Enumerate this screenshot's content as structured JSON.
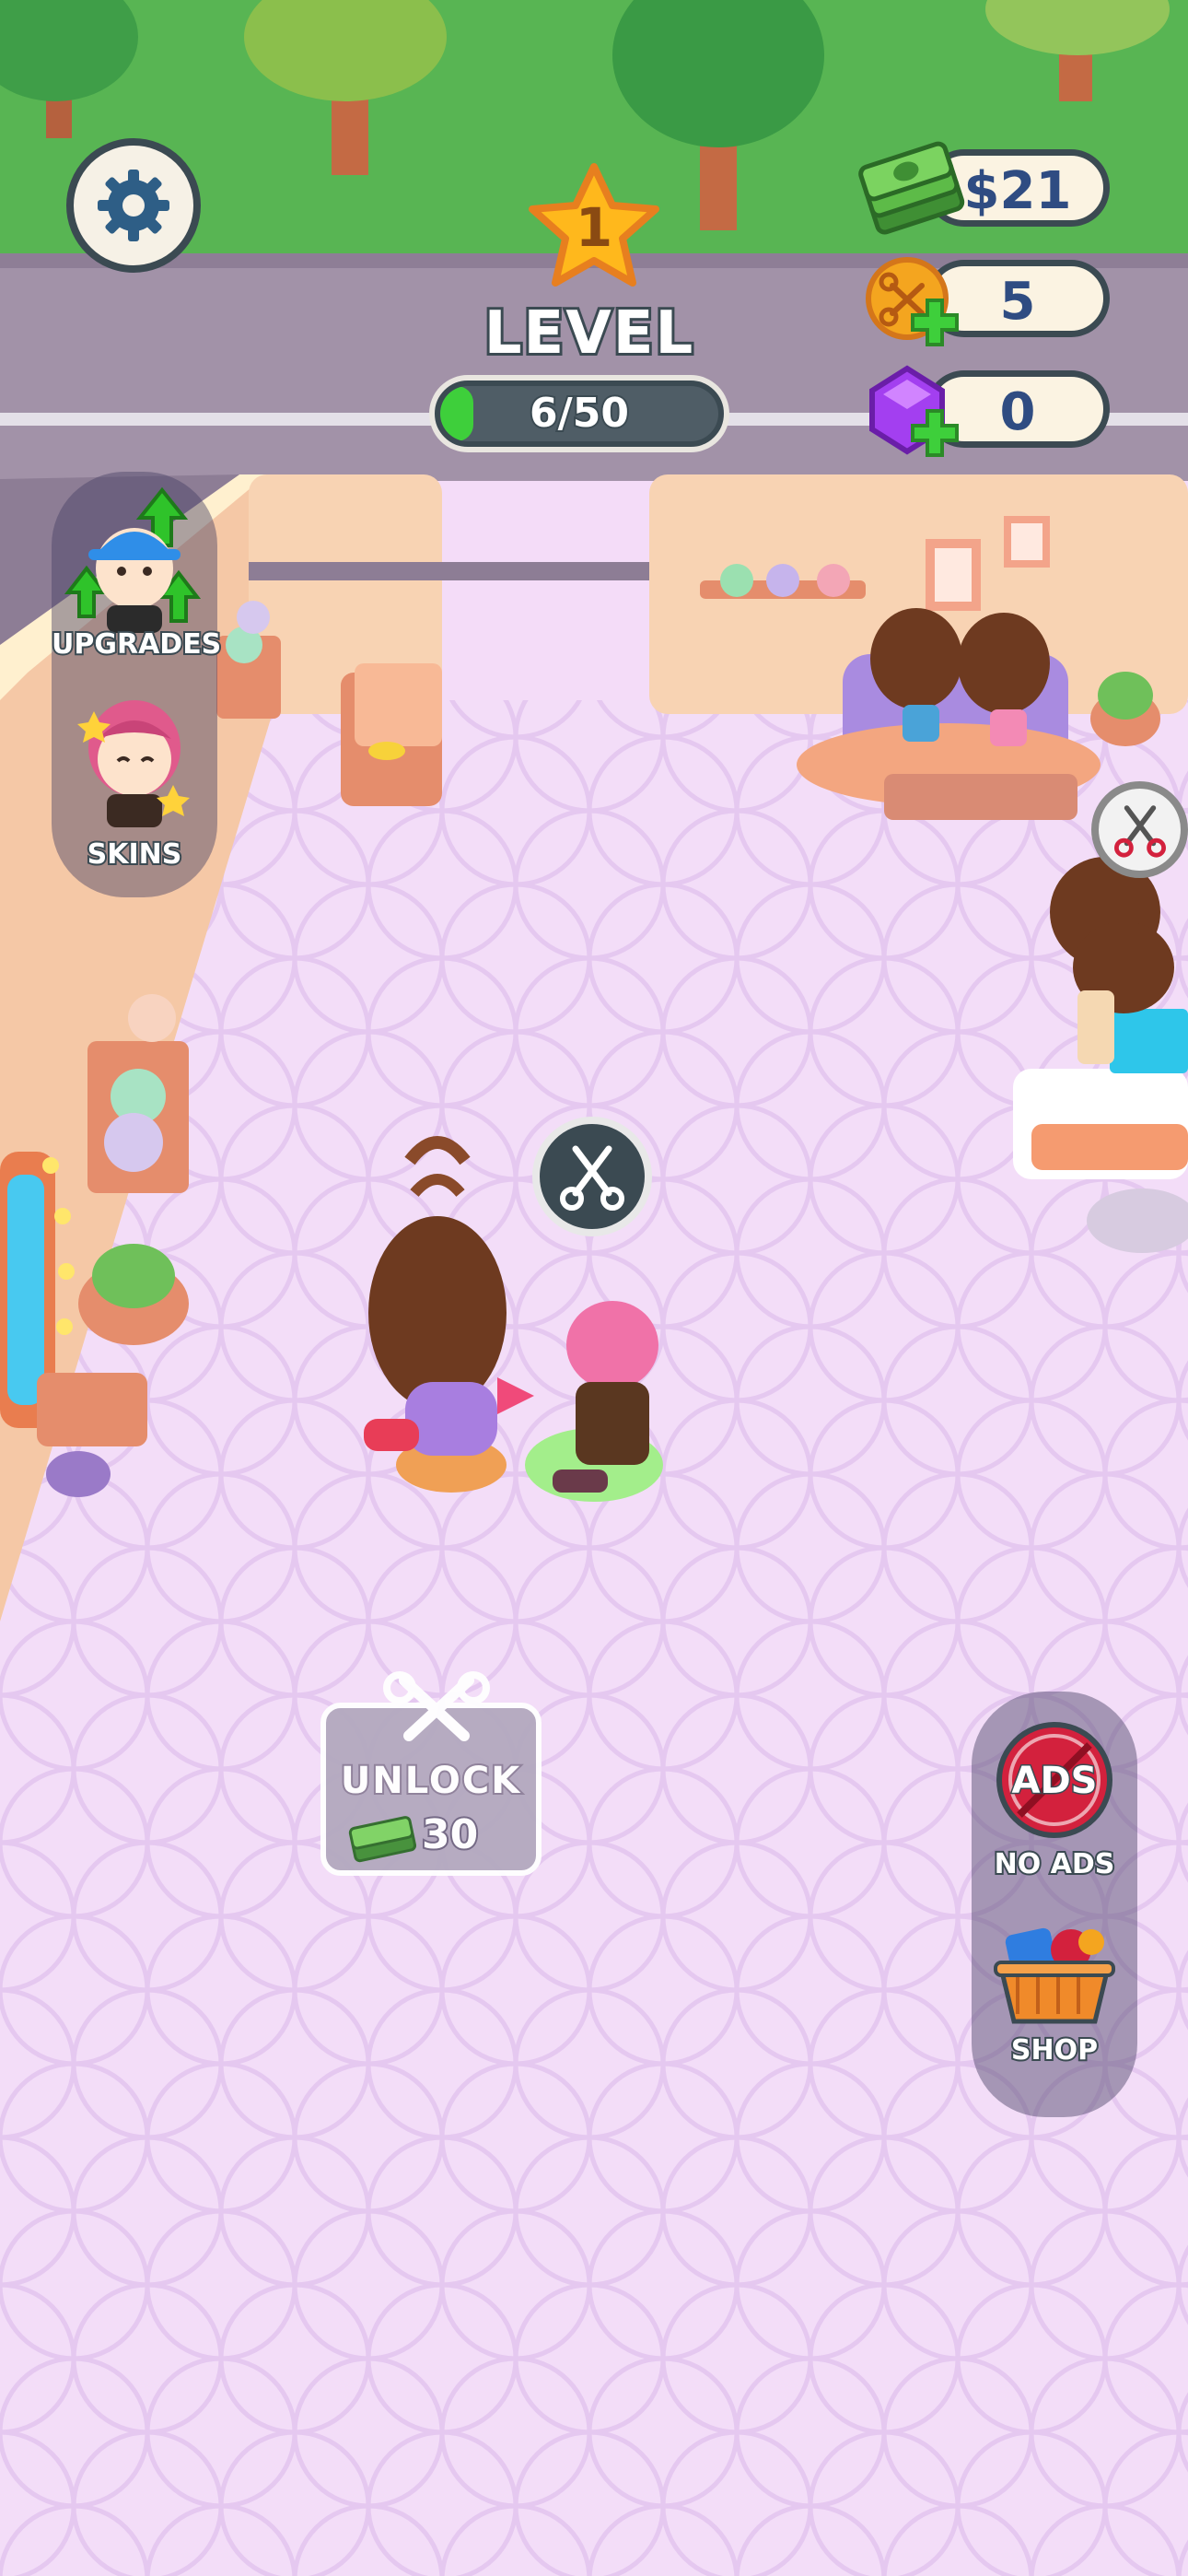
{
  "hud": {
    "level_number": "1",
    "level_label": "LEVEL",
    "level_progress_text": "6/50",
    "level_progress_fraction": 0.12,
    "cash": "$21",
    "scissors_tokens": "5",
    "gems": "0"
  },
  "side_menu": {
    "upgrades_label": "UPGRADES",
    "skins_label": "SKINS"
  },
  "right_menu": {
    "no_ads_label": "NO ADS",
    "no_ads_badge": "ADS",
    "shop_label": "SHOP"
  },
  "unlock_station": {
    "label": "UNLOCK",
    "cost": "30"
  },
  "icons": {
    "settings": "gear-icon",
    "cash": "cash-stack-icon",
    "scissors_token": "scissors-coin-icon",
    "gem": "purple-gem-icon",
    "action": "scissors-icon"
  },
  "colors": {
    "accent_green": "#3ecf3b",
    "text_blue": "#2f4c82",
    "outline": "#3b4a52",
    "no_ads_red": "#d3213d"
  }
}
